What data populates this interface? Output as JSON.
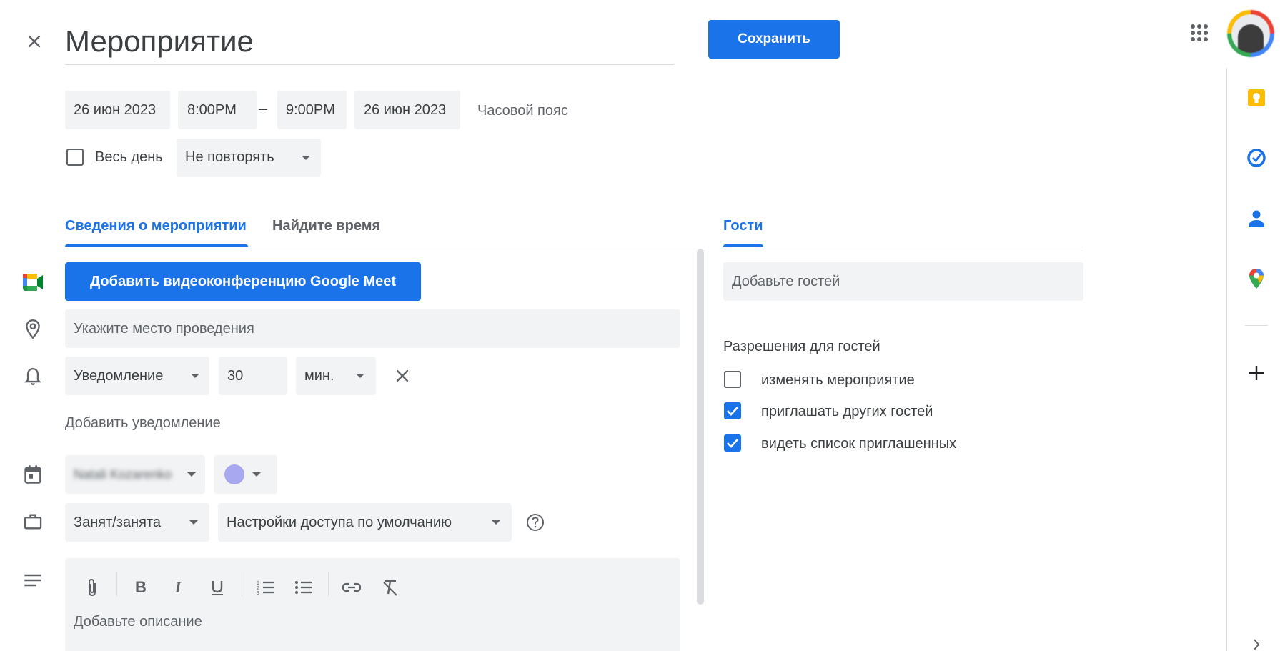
{
  "header": {
    "title": "Мероприятие",
    "save_label": "Сохранить"
  },
  "datetime": {
    "start_date": "26 июн 2023",
    "start_time": "8:00PM",
    "dash": "–",
    "end_time": "9:00PM",
    "end_date": "26 июн 2023",
    "timezone_label": "Часовой пояс",
    "all_day_label": "Весь день",
    "all_day_checked": false,
    "repeat_value": "Не повторять"
  },
  "tabs": [
    {
      "label": "Сведения о мероприятии",
      "active": true
    },
    {
      "label": "Найдите время",
      "active": false
    }
  ],
  "details": {
    "meet_button_label": "Добавить видеоконференцию Google Meet",
    "location_placeholder": "Укажите место проведения",
    "notification_type": "Уведомление",
    "notification_amount": "30",
    "notification_unit": "мин.",
    "add_notification_label": "Добавить уведомление",
    "calendar_owner": "Natali Kozarenko",
    "calendar_color": "#a8a8f0",
    "busy_status": "Занят/занята",
    "visibility": "Настройки доступа по умолчанию",
    "description_placeholder": "Добавьте описание"
  },
  "guests": {
    "tab_label": "Гости",
    "add_placeholder": "Добавьте гостей",
    "permissions_title": "Разрешения для гостей",
    "permissions": [
      {
        "label": "изменять мероприятие",
        "checked": false
      },
      {
        "label": "приглашать других гостей",
        "checked": true
      },
      {
        "label": "видеть список приглашенных",
        "checked": true
      }
    ]
  },
  "colors": {
    "accent": "#1a73e8",
    "field_bg": "#f1f3f4",
    "text": "#3c4043",
    "muted": "#5f6368"
  }
}
